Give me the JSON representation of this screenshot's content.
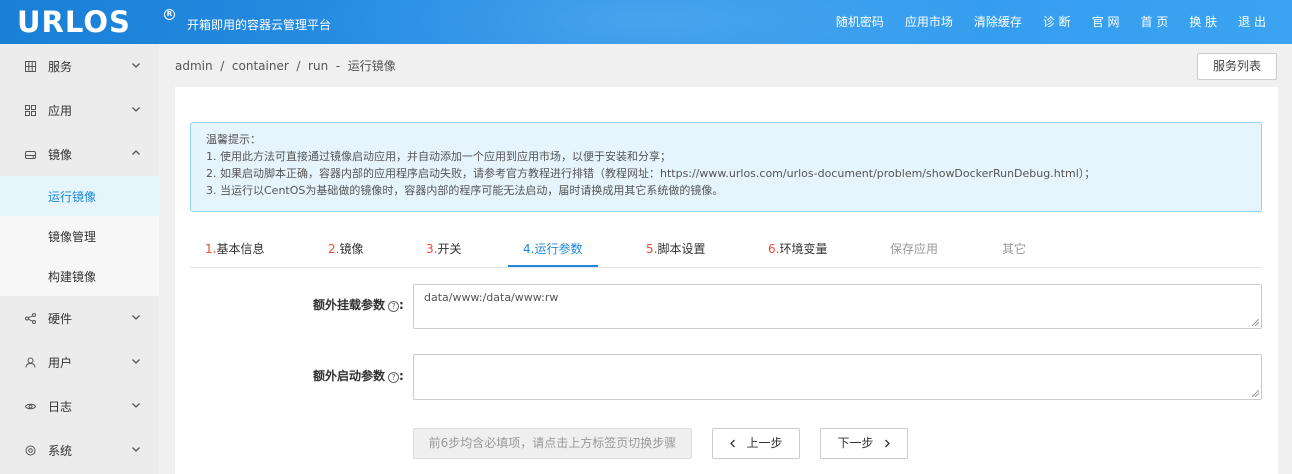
{
  "header": {
    "logo": "URLOS",
    "logo_mark": "R",
    "subtitle": "开箱即用的容器云管理平台",
    "nav": [
      "随机密码",
      "应用市场",
      "清除缓存",
      "诊 断",
      "官 网",
      "首 页",
      "换 肤",
      "退 出"
    ]
  },
  "sidebar": {
    "items": [
      {
        "label": "服务",
        "icon": "grid-icon"
      },
      {
        "label": "应用",
        "icon": "apps-icon"
      },
      {
        "label": "镜像",
        "icon": "disk-icon"
      },
      {
        "label": "硬件",
        "icon": "share-icon"
      },
      {
        "label": "用户",
        "icon": "user-icon"
      },
      {
        "label": "日志",
        "icon": "eye-icon"
      },
      {
        "label": "系统",
        "icon": "gear-icon"
      }
    ],
    "sub_items": [
      "运行镜像",
      "镜像管理",
      "构建镜像"
    ]
  },
  "breadcrumb": "admin  /  container  /  run  -  运行镜像",
  "service_list_button": "服务列表",
  "notice": {
    "title": "温馨提示：",
    "lines": [
      "1. 使用此方法可直接通过镜像启动应用，并自动添加一个应用到应用市场，以便于安装和分享；",
      "2. 如果启动脚本正确，容器内部的应用程序启动失败，请参考官方教程进行排错（教程网址：https://www.urlos.com/urlos-document/problem/showDockerRunDebug.html）；",
      "3. 当运行以CentOS为基础做的镜像时，容器内部的程序可能无法启动，届时请换成用其它系统做的镜像。"
    ]
  },
  "tabs": [
    {
      "num": "1.",
      "label": "基本信息"
    },
    {
      "num": "2.",
      "label": "镜像"
    },
    {
      "num": "3.",
      "label": "开关"
    },
    {
      "num": "4.",
      "label": "运行参数"
    },
    {
      "num": "5.",
      "label": "脚本设置"
    },
    {
      "num": "6.",
      "label": "环境变量"
    },
    {
      "num": "",
      "label": "保存应用"
    },
    {
      "num": "",
      "label": "其它"
    }
  ],
  "form": {
    "mount_label": "额外挂载参数",
    "mount_value": "data/www:/data/www:rw",
    "start_label": "额外启动参数",
    "start_value": "",
    "label_suffix": ":"
  },
  "buttons": {
    "hint": "前6步均含必填项，请点击上方标签页切换步骤",
    "prev": "上一步",
    "next": "下一步"
  },
  "colors": {
    "accent": "#1e88d9",
    "step_number": "#e84d2c",
    "notice_bg": "#e6f5fd"
  }
}
